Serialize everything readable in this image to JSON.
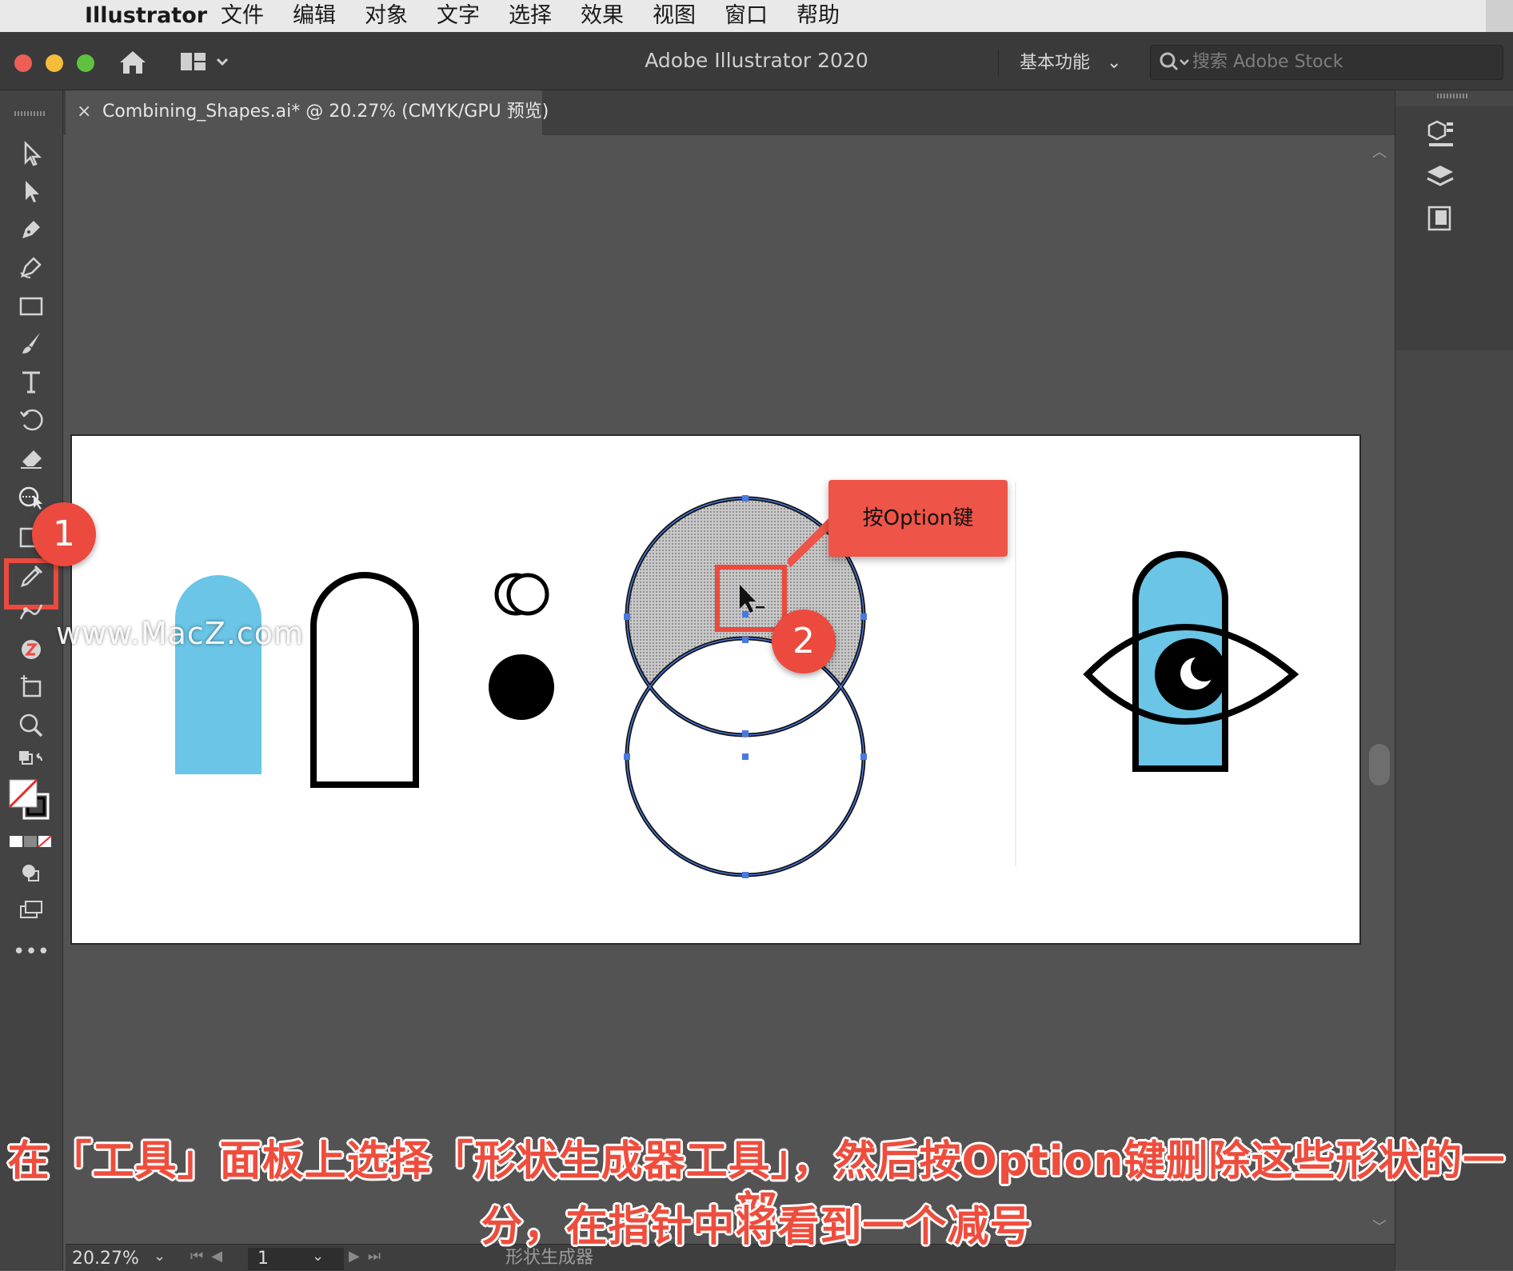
{
  "menubar": {
    "app_name": "Illustrator",
    "items": [
      "文件",
      "编辑",
      "对象",
      "文字",
      "选择",
      "效果",
      "视图",
      "窗口",
      "帮助"
    ]
  },
  "titlebar": {
    "title": "Adobe Illustrator 2020",
    "workspace": "基本功能",
    "search_placeholder": "搜索 Adobe Stock"
  },
  "document_tab": {
    "close": "×",
    "label": "Combining_Shapes.ai* @ 20.27% (CMYK/GPU 预览)"
  },
  "statusbar": {
    "zoom": "20.27%",
    "page": "1",
    "current_tool": "形状生成器"
  },
  "callouts": {
    "badge_1": "1",
    "badge_2": "2",
    "option_key": "按Option键"
  },
  "watermark": "www.MacZ.com",
  "subtitle": {
    "line1": "在「工具」面板上选择「形状生成器工具」，然后按Option键删除这些形状的一部",
    "line2": "分，在指针中将看到一个减号"
  },
  "colors": {
    "accent_red": "#ec4a3e",
    "shape_blue": "#6ac5e6",
    "selection_blue": "#4a78e0"
  },
  "tools": [
    "selection-tool",
    "direct-selection-tool",
    "pen-tool",
    "curvature-tool",
    "rectangle-tool",
    "paintbrush-tool",
    "type-tool",
    "rotate-tool",
    "eraser-tool",
    "shape-builder-tool",
    "gradient-tool",
    "eyedropper-tool",
    "blend-tool",
    "symbol-sprayer-tool",
    "artboard-tool",
    "zoom-tool"
  ]
}
